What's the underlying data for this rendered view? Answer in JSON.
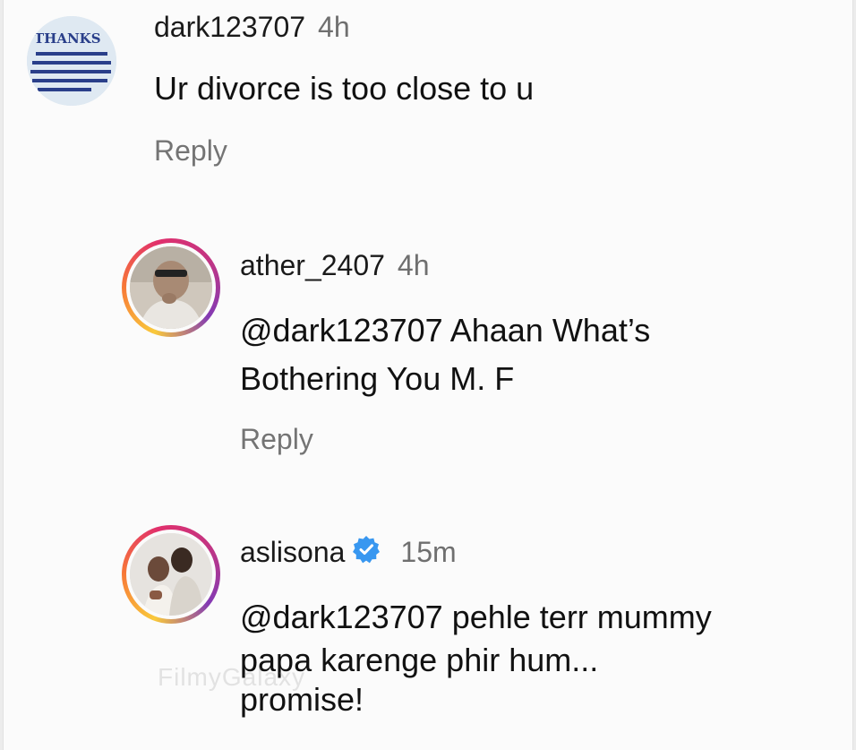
{
  "comments": [
    {
      "username": "dark123707",
      "time": "4h",
      "text_lines": [
        "Ur divorce is too close to u"
      ],
      "reply_label": "Reply",
      "avatar_text": "THANKS",
      "avatar_icon": "thanks-note-avatar"
    },
    {
      "username": "ather_2407",
      "time": "4h",
      "text_lines": [
        "@dark123707 Ahaan What’s",
        "Bothering You M. F"
      ],
      "reply_label": "Reply",
      "avatar_icon": "profile-photo-man-avatar"
    },
    {
      "username": "aslisona",
      "verified": true,
      "time": "15m",
      "text_lines": [
        "@dark123707 pehle terr mummy",
        "papa karenge phir hum...",
        "promise!"
      ],
      "avatar_icon": "profile-photo-couple-avatar"
    }
  ],
  "watermark": "FilmyGalaxy",
  "colors": {
    "verified_badge": "#3897f0",
    "story_ring": "#e1306c",
    "meta_text": "#747474"
  }
}
